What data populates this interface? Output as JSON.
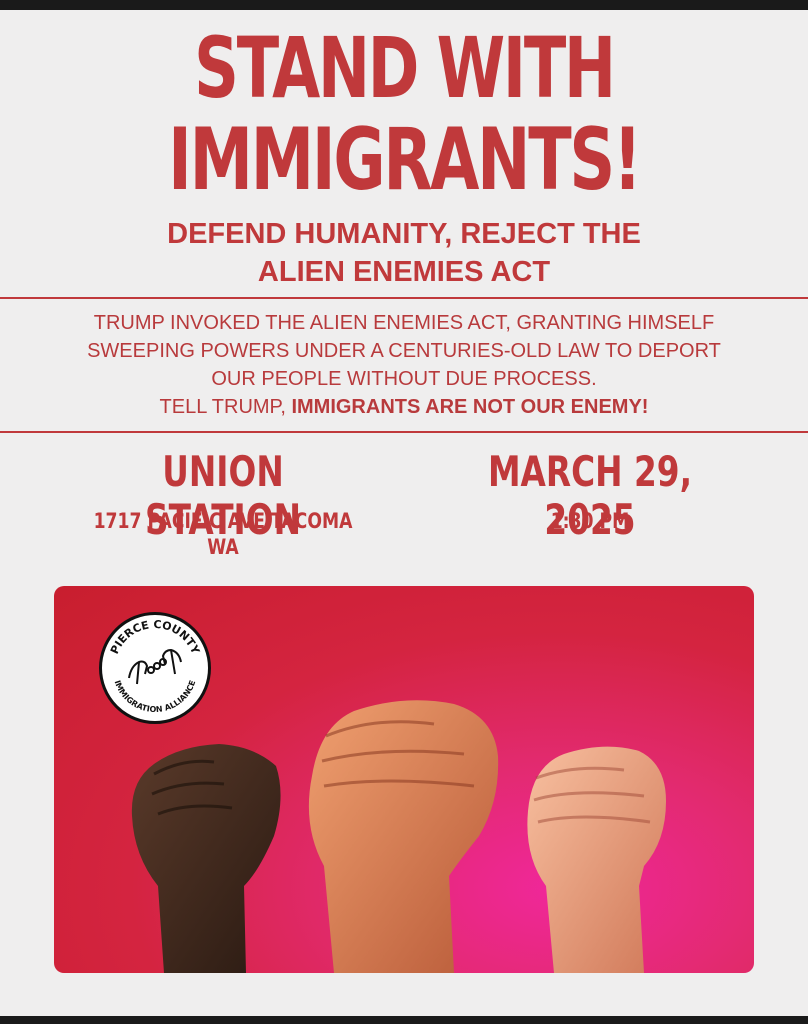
{
  "headline": {
    "line1": "STAND WITH",
    "line2": "IMMIGRANTS!"
  },
  "subheadline": {
    "line1": "DEFEND HUMANITY, REJECT THE",
    "line2": "ALIEN ENEMIES ACT"
  },
  "body": {
    "line1": "TRUMP INVOKED THE ALIEN ENEMIES ACT, GRANTING HIMSELF",
    "line2": "SWEEPING POWERS UNDER A CENTURIES-OLD LAW TO DEPORT",
    "line3": "OUR PEOPLE WITHOUT DUE PROCESS.",
    "line4_prefix": "TELL TRUMP, ",
    "line4_emphasis": "IMMIGRANTS ARE NOT OUR ENEMY!"
  },
  "event": {
    "venue": "UNION STATION",
    "address": "1717 PACIFIC AVE TACOMA WA",
    "date": "MARCH 29, 2025",
    "time": "1:30 PM"
  },
  "logo": {
    "top_text": "PIERCE COUNTY",
    "bottom_text": "IMMIGRATION ALLIANCE",
    "icon": "broken-chain-hands-icon"
  },
  "colors": {
    "accent": "#c0393b",
    "background": "#efeeee",
    "photo_red": "#c81e2e",
    "photo_magenta": "#f0279a"
  }
}
